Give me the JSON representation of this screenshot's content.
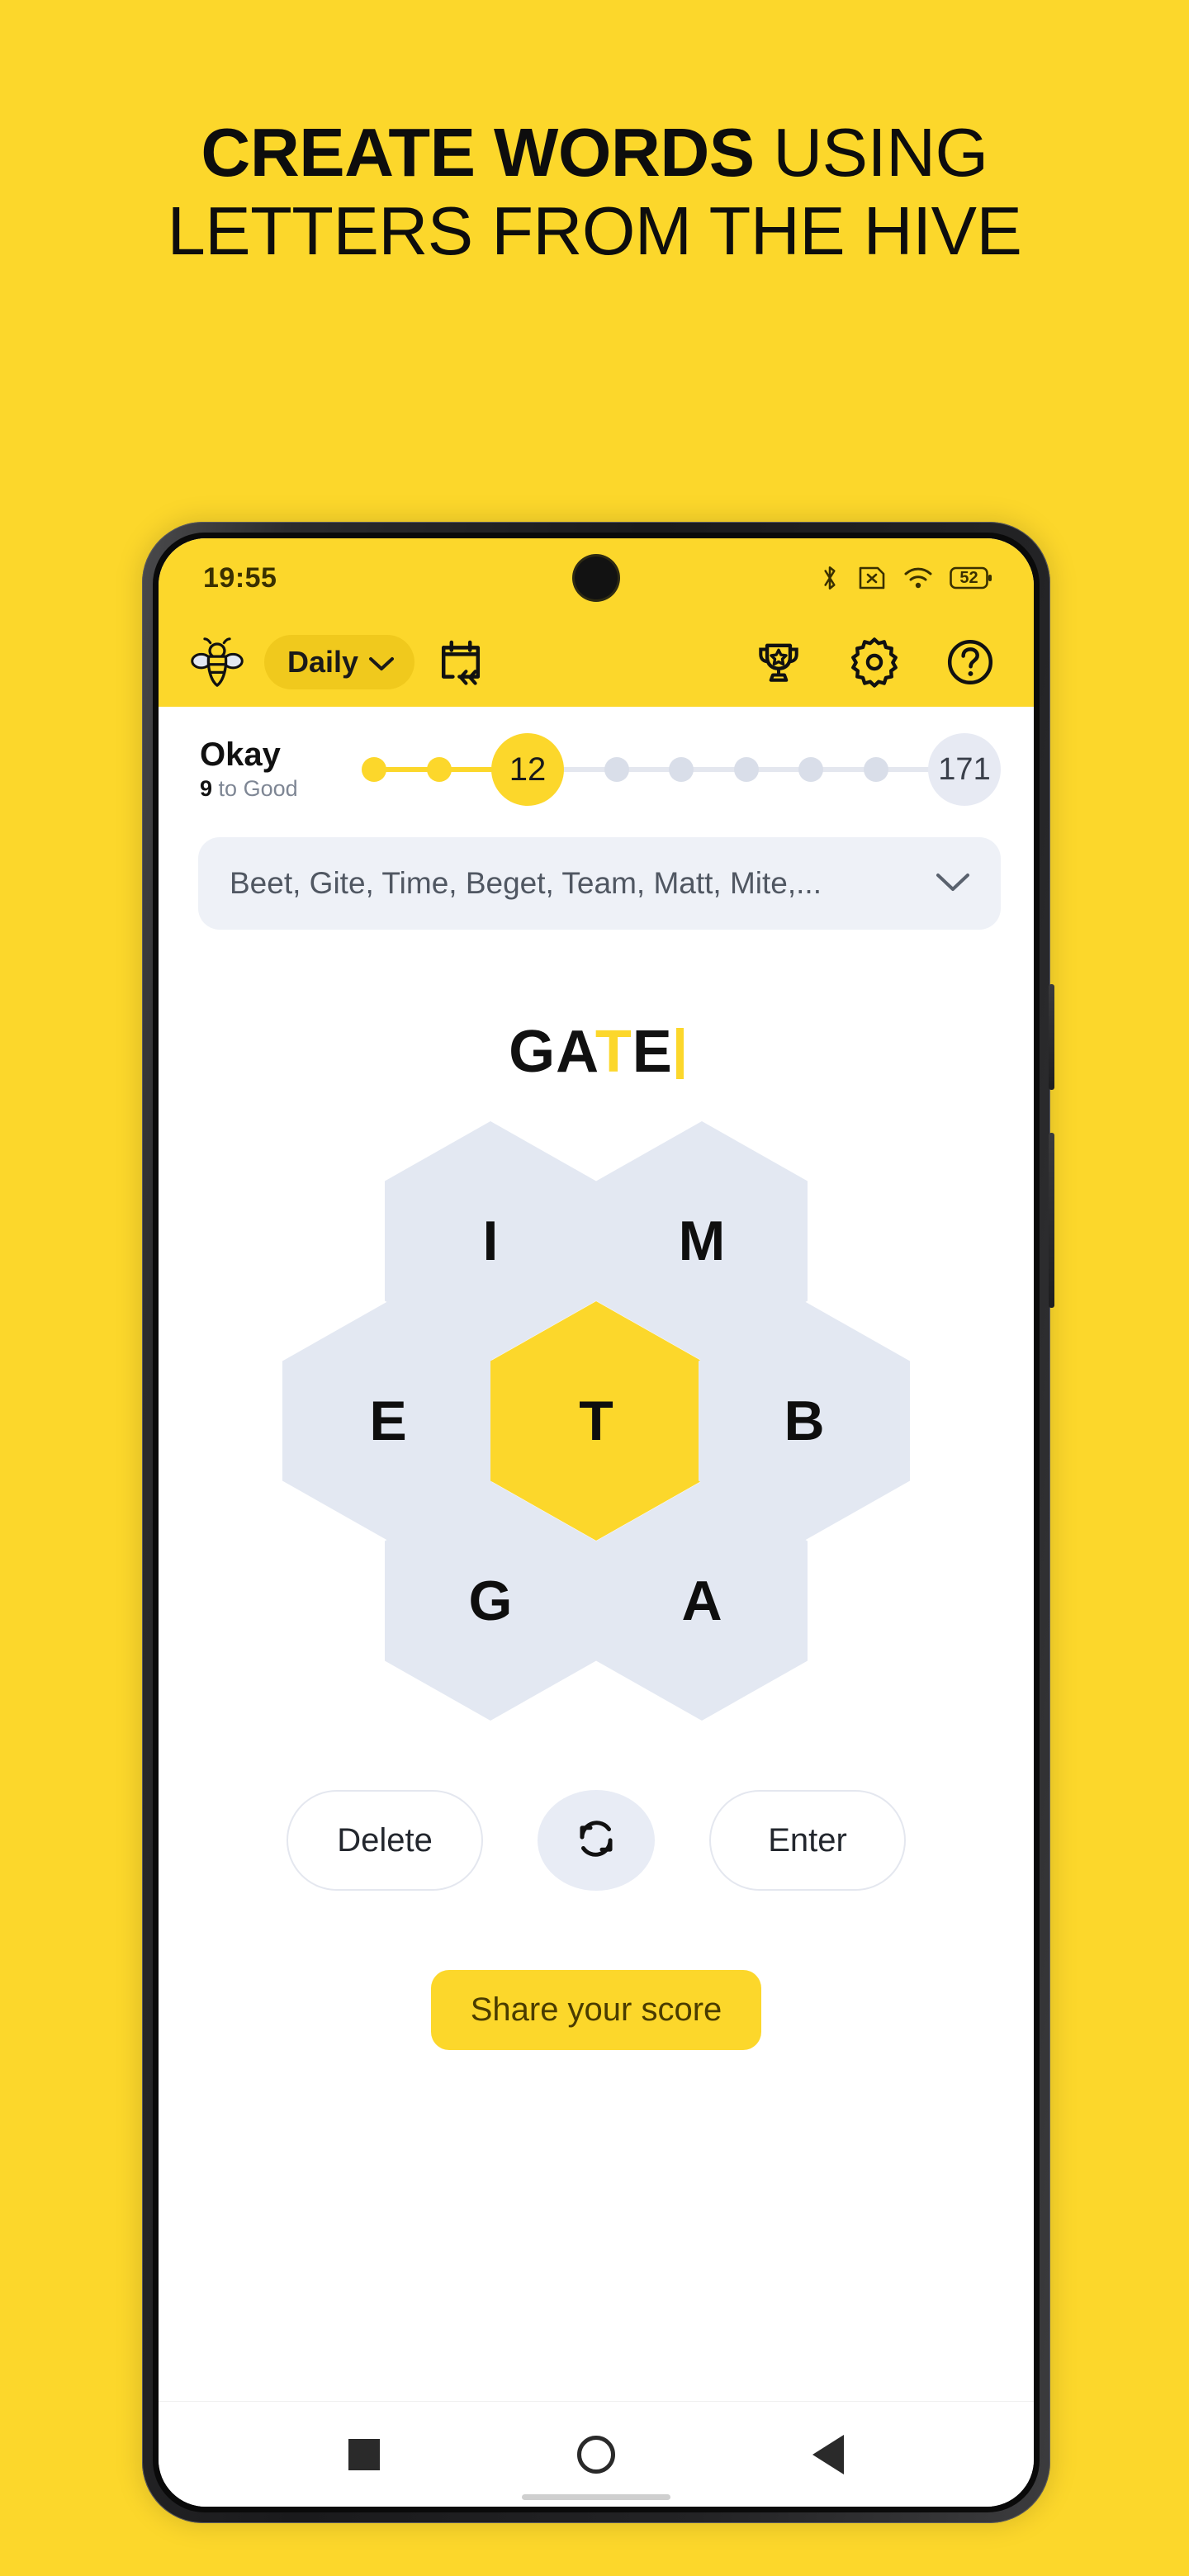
{
  "promo": {
    "headline_line1_bold": "CREATE WORDS",
    "headline_line1_rest": " USING",
    "headline_line2": "LETTERS FROM THE HIVE",
    "background_color": "#FCD72B"
  },
  "status_bar": {
    "time": "19:55",
    "icons": [
      "bluetooth-icon",
      "sim-missing-icon",
      "wifi-icon",
      "battery-icon"
    ],
    "battery_percent": "52"
  },
  "toolbar": {
    "logo": "bee-icon",
    "mode_label": "Daily",
    "mode_chevron": "chevron-down-icon",
    "calendar_label": "calendar-rewind-icon",
    "trophy_label": "trophy-icon",
    "settings_label": "gear-icon",
    "help_label": "help-circle-icon"
  },
  "progress": {
    "rank_title": "Okay",
    "points_to_next": "9",
    "next_rank_suffix": " to Good",
    "next_rank_text": "to Good",
    "current_score": "12",
    "max_score": "171",
    "steps_total": 9,
    "steps_completed": 2,
    "fill_color": "#FCD72B",
    "track_color": "#E4E7EF"
  },
  "found_words": {
    "summary": "Beet, Gite, Time, Beget, Team, Matt, Mite,...",
    "chevron": "chevron-down-icon"
  },
  "entry": {
    "prefix": "GA",
    "center_letter": "T",
    "suffix": "E",
    "full_text": "GATE",
    "caret_color": "#FCD72B"
  },
  "hive": {
    "center": {
      "letter": "T",
      "color": "#FCD72B"
    },
    "outer_color": "#E3E8F2",
    "cells": [
      {
        "letter": "I",
        "position": "top-left"
      },
      {
        "letter": "M",
        "position": "top-right"
      },
      {
        "letter": "E",
        "position": "left"
      },
      {
        "letter": "B",
        "position": "right"
      },
      {
        "letter": "G",
        "position": "bottom-left"
      },
      {
        "letter": "A",
        "position": "bottom-right"
      }
    ]
  },
  "controls": {
    "delete_label": "Delete",
    "shuffle_label": "shuffle-icon",
    "enter_label": "Enter"
  },
  "share": {
    "label": "Share your score",
    "color": "#FCD72B"
  },
  "nav": {
    "recents": "square-icon",
    "home": "circle-icon",
    "back": "triangle-back-icon"
  }
}
